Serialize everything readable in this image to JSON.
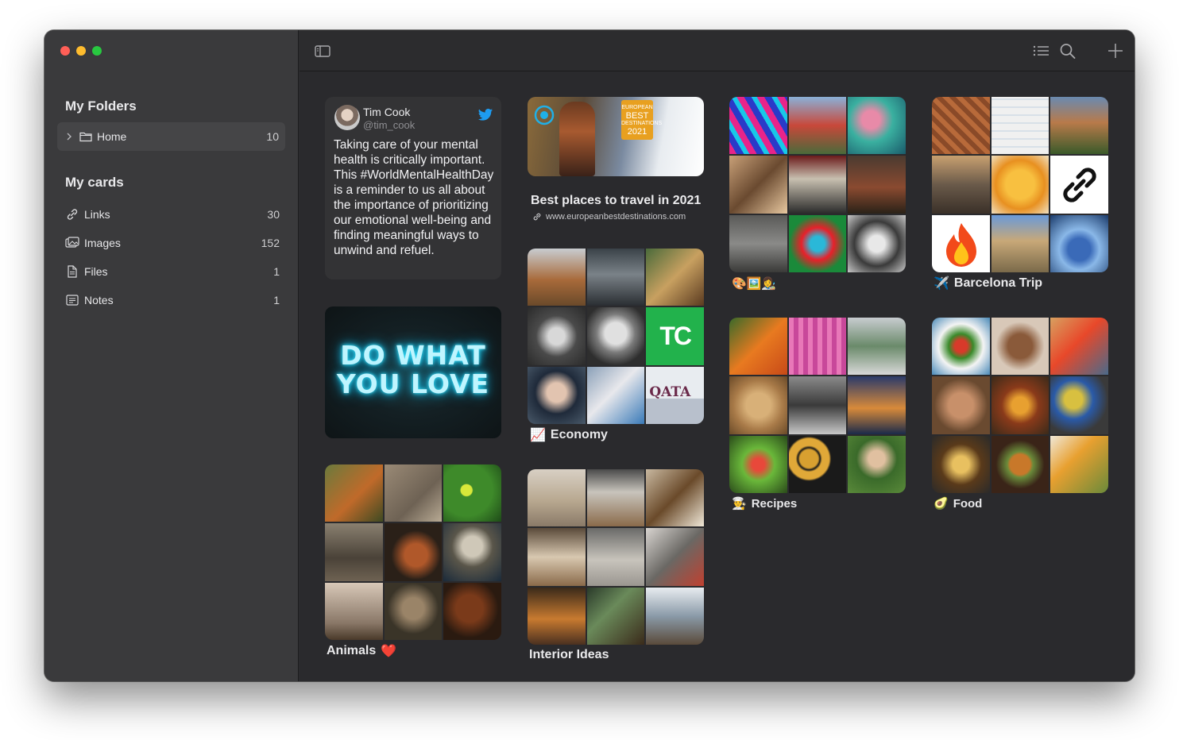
{
  "sidebar": {
    "folders_title": "My Folders",
    "folder": {
      "name": "Home",
      "count": "10"
    },
    "cards_title": "My cards",
    "items": [
      {
        "label": "Links",
        "count": "30",
        "icon": "link-icon"
      },
      {
        "label": "Images",
        "count": "152",
        "icon": "images-icon"
      },
      {
        "label": "Files",
        "count": "1",
        "icon": "file-icon"
      },
      {
        "label": "Notes",
        "count": "1",
        "icon": "notes-icon"
      }
    ]
  },
  "toolbar": {
    "icons": [
      "sidebar-toggle-icon",
      "list-icon",
      "search-icon",
      "plus-icon"
    ]
  },
  "tweet": {
    "name": "Tim Cook",
    "handle": "@tim_cook",
    "text": "Taking care of your mental health is critically important. This #WorldMentalHealthDay is a reminder to us all about the importance of prioritizing our emotional well-being and finding meaningful ways to unwind and refuel."
  },
  "neon": {
    "line1": "DO WHAT",
    "line2": "YOU LOVE"
  },
  "link_card": {
    "title": "Best places to travel in 2021",
    "url": "www.europeanbestdestinations.com",
    "badge_lines": [
      "EUROPEAN",
      "BEST",
      "DESTINATIONS",
      "2021"
    ]
  },
  "boards": {
    "economy": {
      "title": "Economy",
      "emoji": "📈",
      "tc_logo": "TC",
      "qatar_text": "QATA"
    },
    "animals": {
      "title": "Animals",
      "emoji": "❤️"
    },
    "interior": {
      "title": "Interior Ideas"
    },
    "art": {
      "emojis": "🎨🖼️👩‍🎨"
    },
    "recipes": {
      "title": "Recipes",
      "emoji": "👨‍🍳"
    },
    "barcelona": {
      "title": "Barcelona Trip",
      "emoji": "✈️"
    },
    "food": {
      "title": "Food",
      "emoji": "🥑"
    }
  }
}
